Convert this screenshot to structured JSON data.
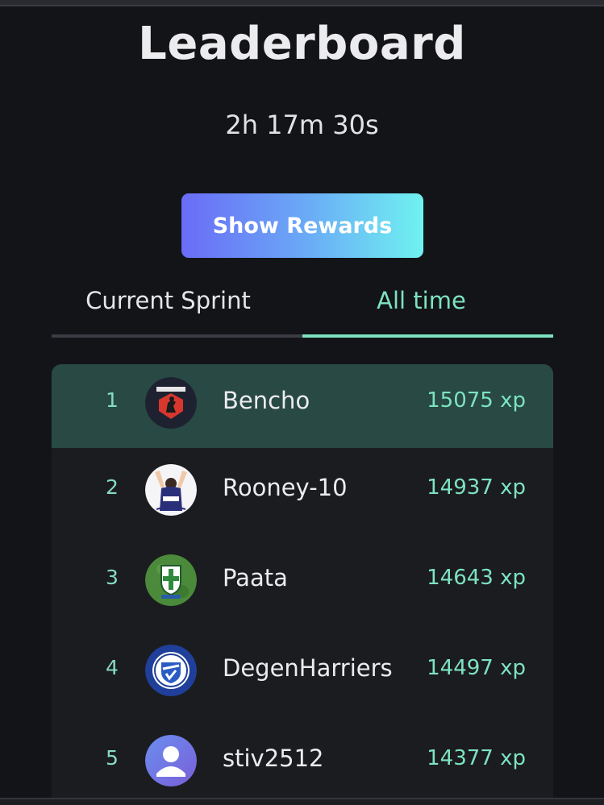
{
  "header": {
    "title": "Leaderboard",
    "timer": "2h 17m 30s",
    "rewards_button_label": "Show Rewards"
  },
  "tabs": [
    {
      "label": "Current Sprint",
      "active": false
    },
    {
      "label": "All time",
      "active": true
    }
  ],
  "leaderboard": {
    "rows": [
      {
        "rank": "1",
        "username": "Bencho",
        "xp": "15075 xp",
        "avatar_icon": "red-crest-avatar-icon",
        "highlighted": true
      },
      {
        "rank": "2",
        "username": "Rooney-10",
        "xp": "14937 xp",
        "avatar_icon": "player-celebration-avatar-icon",
        "highlighted": false
      },
      {
        "rank": "3",
        "username": "Paata",
        "xp": "14643 xp",
        "avatar_icon": "green-club-badge-avatar-icon",
        "highlighted": false
      },
      {
        "rank": "4",
        "username": "DegenHarriers",
        "xp": "14497 xp",
        "avatar_icon": "blue-club-badge-avatar-icon",
        "highlighted": false
      },
      {
        "rank": "5",
        "username": "stiv2512",
        "xp": "14377 xp",
        "avatar_icon": "default-user-avatar-icon",
        "highlighted": false
      }
    ]
  },
  "colors": {
    "background": "#131418",
    "accent": "#7de3bf",
    "highlight_row": "#284944",
    "button_gradient_start": "#6a6cf7",
    "button_gradient_end": "#6ff2f0"
  }
}
